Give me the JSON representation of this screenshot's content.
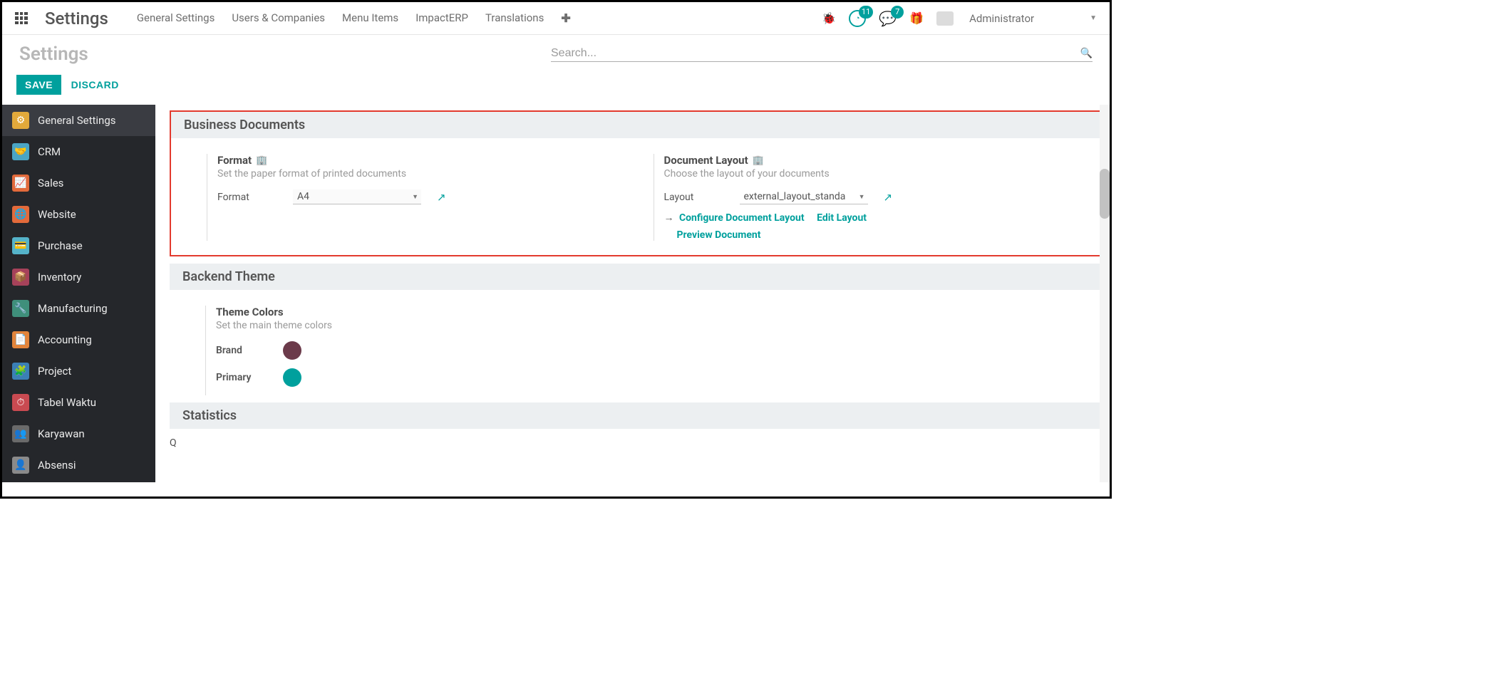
{
  "app_title": "Settings",
  "nav_menu": {
    "general": "General Settings",
    "users": "Users & Companies",
    "menu_items": "Menu Items",
    "impacterp": "ImpactERP",
    "translations": "Translations"
  },
  "badges": {
    "clock": "11",
    "messages": "7"
  },
  "user": "Administrator",
  "page_title": "Settings",
  "search": {
    "placeholder": "Search..."
  },
  "actions": {
    "save": "SAVE",
    "discard": "DISCARD"
  },
  "sidebar": [
    {
      "label": "General Settings",
      "bg": "#e2a93b"
    },
    {
      "label": "CRM",
      "bg": "#4aa5c4"
    },
    {
      "label": "Sales",
      "bg": "#e26a3b"
    },
    {
      "label": "Website",
      "bg": "#e26a3b"
    },
    {
      "label": "Purchase",
      "bg": "#55b3c9"
    },
    {
      "label": "Inventory",
      "bg": "#a6425a"
    },
    {
      "label": "Manufacturing",
      "bg": "#3f8f7b"
    },
    {
      "label": "Accounting",
      "bg": "#e2843b"
    },
    {
      "label": "Project",
      "bg": "#3b7fb5"
    },
    {
      "label": "Tabel Waktu",
      "bg": "#c94a51"
    },
    {
      "label": "Karyawan",
      "bg": "#6a6a6a"
    },
    {
      "label": "Absensi",
      "bg": "#8a8a8a"
    }
  ],
  "sections": {
    "business_docs": {
      "header": "Business Documents",
      "format": {
        "title": "Format",
        "desc": "Set the paper format of printed documents",
        "label": "Format",
        "value": "A4"
      },
      "layout": {
        "title": "Document Layout",
        "desc": "Choose the layout of your documents",
        "label": "Layout",
        "value": "external_layout_standa",
        "configure": "Configure Document Layout",
        "edit": "Edit Layout",
        "preview": "Preview Document"
      }
    },
    "backend_theme": {
      "header": "Backend Theme",
      "colors_title": "Theme Colors",
      "colors_desc": "Set the main theme colors",
      "brand_label": "Brand",
      "brand_color": "#6b3a4a",
      "primary_label": "Primary",
      "primary_color": "#00a09d"
    },
    "statistics": {
      "header": "Statistics"
    }
  }
}
